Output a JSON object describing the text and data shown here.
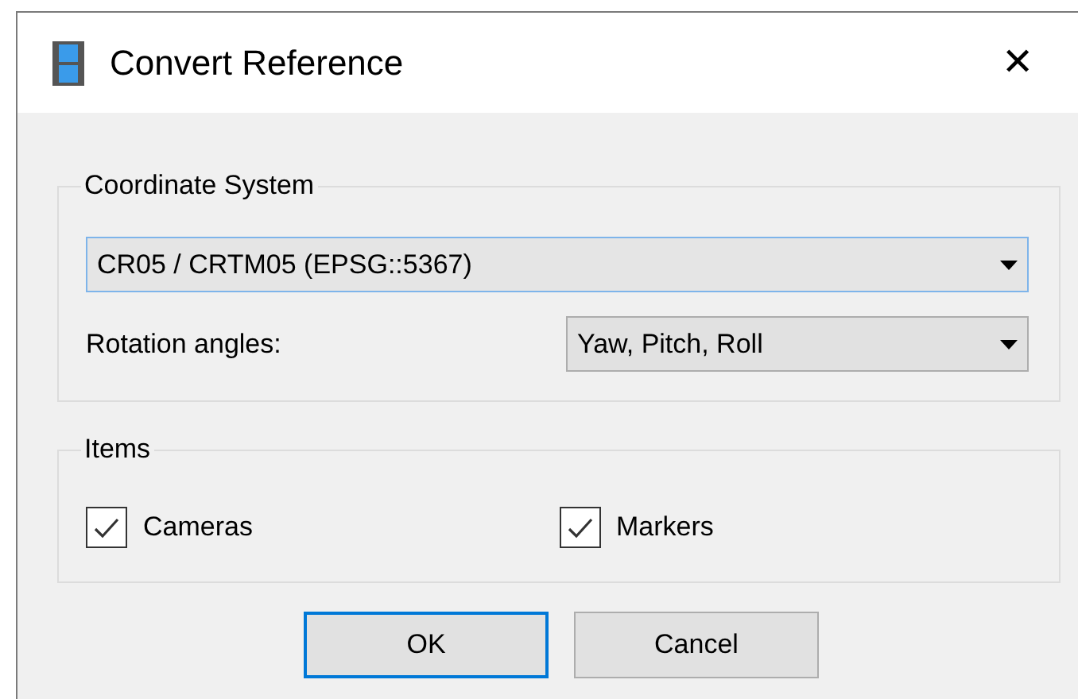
{
  "window": {
    "title": "Convert Reference",
    "close": "✕"
  },
  "coordinate_system": {
    "title": "Coordinate System",
    "crs": {
      "value": "CR05 / CRTM05 (EPSG::5367)"
    },
    "rotation": {
      "label": "Rotation angles:",
      "value": "Yaw, Pitch, Roll"
    }
  },
  "items": {
    "title": "Items",
    "checkboxes": [
      {
        "label": "Cameras",
        "checked": true
      },
      {
        "label": "Markers",
        "checked": true
      }
    ]
  },
  "buttons": [
    {
      "label": "OK",
      "default": true
    },
    {
      "label": "Cancel",
      "default": false
    }
  ]
}
